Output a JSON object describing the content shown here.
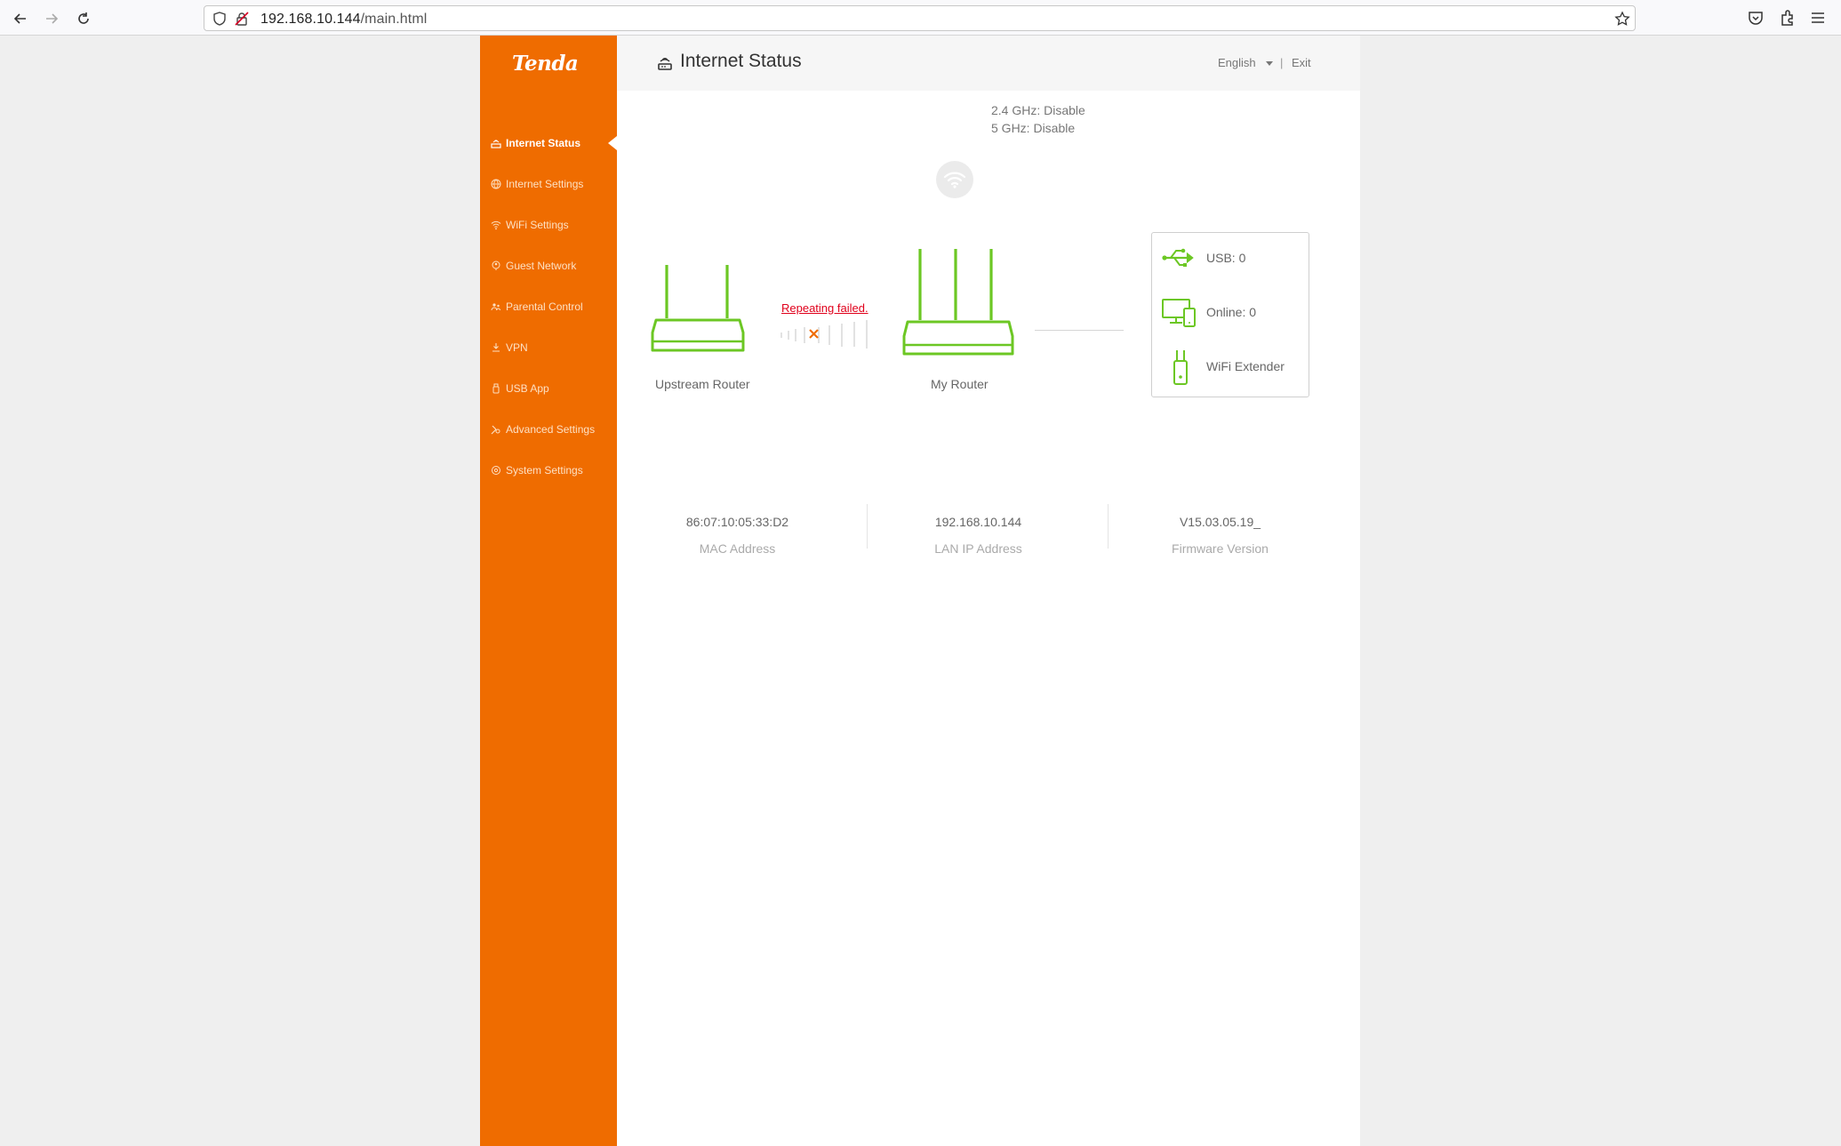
{
  "browser": {
    "url_host": "192.168.10.144",
    "url_path": "/main.html"
  },
  "brand": {
    "logo_text": "Tenda",
    "accent_color": "#ef6c00",
    "device_color": "#6cc724",
    "error_color": "#e0001b"
  },
  "sidebar": {
    "items": [
      {
        "label": "Internet Status",
        "icon": "router-signal-icon",
        "active": true
      },
      {
        "label": "Internet Settings",
        "icon": "globe-icon"
      },
      {
        "label": "WiFi Settings",
        "icon": "wifi-icon"
      },
      {
        "label": "Guest Network",
        "icon": "guest-icon"
      },
      {
        "label": "Parental Control",
        "icon": "parental-icon"
      },
      {
        "label": "VPN",
        "icon": "vpn-icon"
      },
      {
        "label": "USB App",
        "icon": "usb-icon"
      },
      {
        "label": "Advanced Settings",
        "icon": "tools-icon"
      },
      {
        "label": "System Settings",
        "icon": "gear-icon"
      }
    ]
  },
  "header": {
    "title": "Internet Status",
    "language": "English",
    "separator": "|",
    "exit_label": "Exit"
  },
  "wireless": {
    "band_24": "2.4 GHz: Disable",
    "band_5": "5 GHz: Disable"
  },
  "topology": {
    "upstream_label": "Upstream Router",
    "repeat_status": "Repeating failed.",
    "my_router_label": "My Router"
  },
  "status_box": {
    "usb": "USB:  0",
    "online": "Online:  0",
    "extender": "WiFi Extender"
  },
  "info": {
    "mac_value": "86:07:10:05:33:D2",
    "mac_label": "MAC Address",
    "lan_value": "192.168.10.144",
    "lan_label": "LAN IP Address",
    "fw_value": "V15.03.05.19_",
    "fw_label": "Firmware Version"
  }
}
